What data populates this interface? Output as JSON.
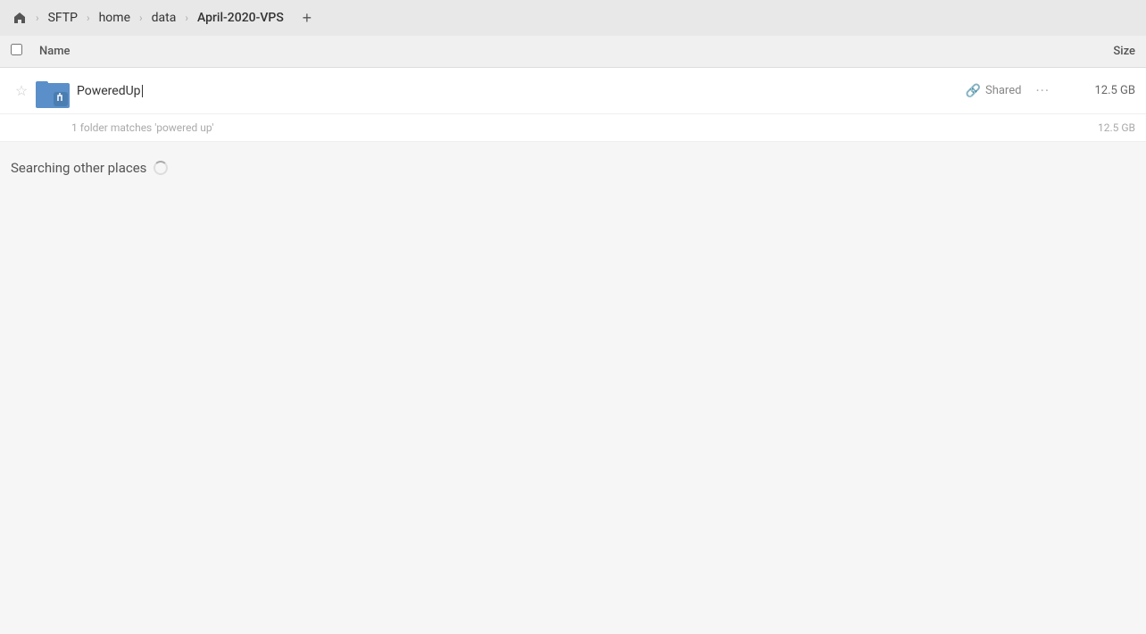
{
  "titlebar": {
    "breadcrumbs": [
      {
        "label": "SFTP",
        "id": "sftp"
      },
      {
        "label": "home",
        "id": "home"
      },
      {
        "label": "data",
        "id": "data"
      },
      {
        "label": "April-2020-VPS",
        "id": "april-2020-vps"
      }
    ],
    "add_button_label": "+"
  },
  "columns": {
    "name": "Name",
    "size": "Size"
  },
  "results": [
    {
      "name": "PoweredUp",
      "cursor_visible": true,
      "shared_label": "Shared",
      "size": "12.5 GB",
      "match_text": "1 folder matches 'powered up'",
      "match_size": "12.5 GB"
    }
  ],
  "other_section": {
    "label": "Searching other places"
  },
  "icons": {
    "home": "⌂",
    "star": "★",
    "link": "🔗",
    "more": "···"
  }
}
